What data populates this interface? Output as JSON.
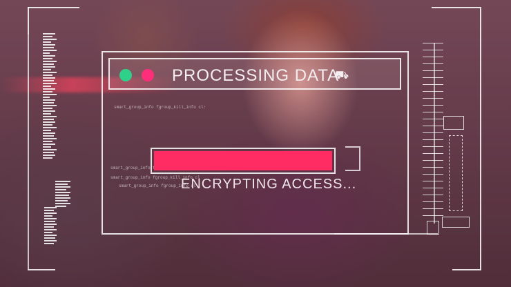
{
  "header": {
    "title": "PROCESSING DATA",
    "title_icon": "cart-icon"
  },
  "window_controls": {
    "green_dot_color": "#2fd08a",
    "pink_dot_color": "#ff2e7a"
  },
  "progress": {
    "fill_fraction": 1.0,
    "fill_color": "#ff2b63"
  },
  "status": {
    "text": "ENCRYPTING ACCESS..."
  },
  "colors": {
    "hud_line": "#ffffff",
    "tint": "#eb3c6e"
  }
}
